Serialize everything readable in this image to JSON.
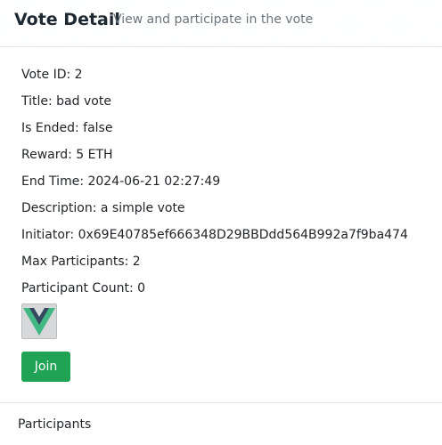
{
  "header": {
    "title": "Vote Detail",
    "subtitle": "View and participate in the vote"
  },
  "vote": {
    "id": "Vote ID: 2",
    "title": "Title: bad vote",
    "is_ended": "Is Ended: false",
    "reward": "Reward: 5 ETH",
    "end_time": "End Time: 2024-06-21 02:27:49",
    "description": "Description: a simple vote",
    "initiator": "Initiator: 0x69E40785ef666348D29BBDdd564B992a7f9ba474",
    "max_participants": "Max Participants: 2",
    "participant_count": "Participant Count: 0"
  },
  "image": {
    "icon": "vue-logo-icon"
  },
  "actions": {
    "join_label": "Join",
    "join_color": "#21a356"
  },
  "participants": {
    "title": "Participants"
  }
}
